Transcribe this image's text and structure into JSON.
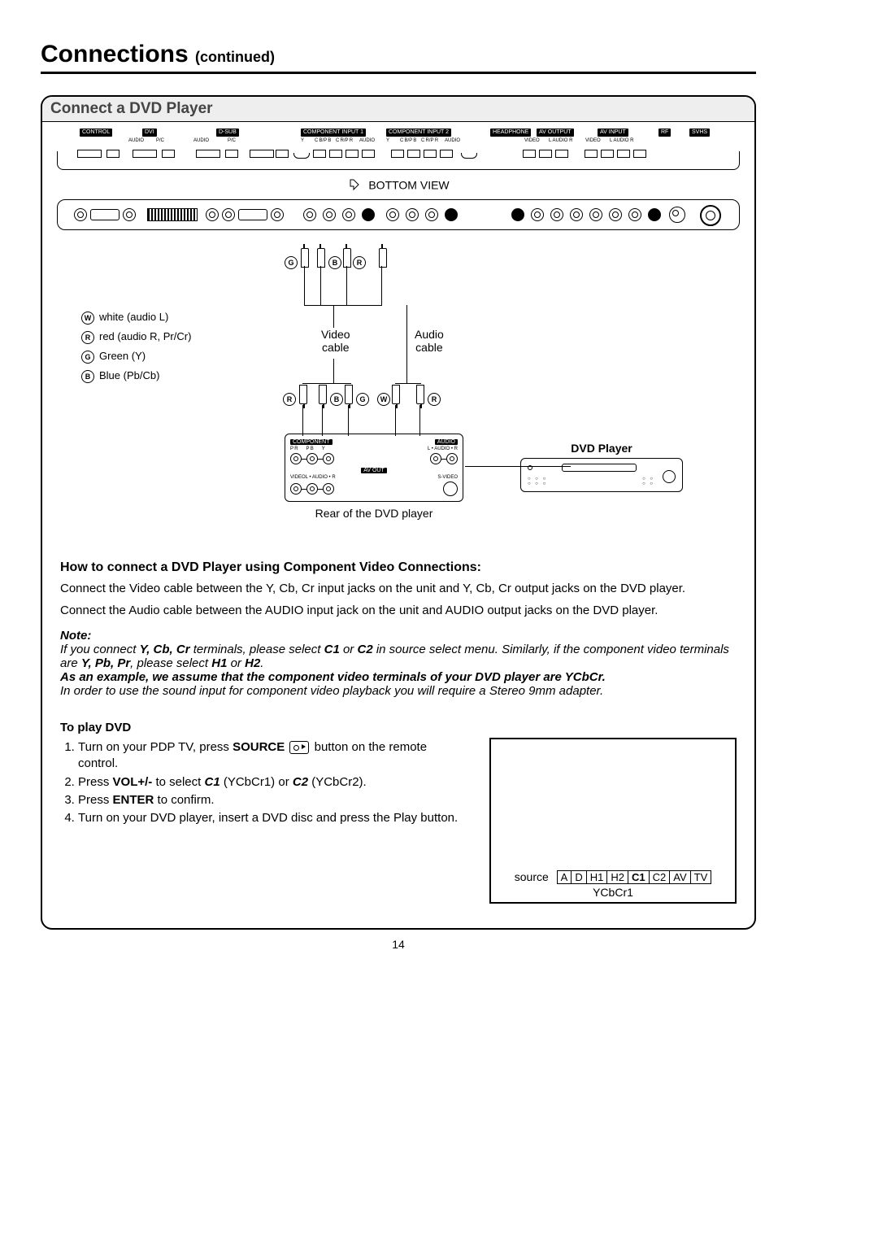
{
  "page_title": "Connections",
  "page_title_sub": "(continued)",
  "panel_title": "Connect a DVD Player",
  "top_labels": {
    "control": "CONTROL",
    "dvi": "DVI",
    "dsub": "D-SUB",
    "audio": "AUDIO",
    "pc": "P/C",
    "comp1": "COMPONENT INPUT 1",
    "comp2": "COMPONENT INPUT 2",
    "headphone": "HEADPHONE",
    "avout": "AV OUTPUT",
    "avin": "AV INPUT",
    "rf": "RF",
    "svhs": "SVHS",
    "y": "Y",
    "cbpb": "C B/P B",
    "crpr": "C R/P R",
    "video": "VIDEO",
    "laudior": "L  AUDIO  R"
  },
  "bottom_view": "BOTTOM VIEW",
  "legend": {
    "w": "white (audio L)",
    "r": "red (audio R, Pr/Cr)",
    "g": "Green (Y)",
    "b": "Blue (Pb/Cb)"
  },
  "cable_video": "Video\ncable",
  "cable_audio": "Audio\ncable",
  "dvd_label": "DVD Player",
  "rear": {
    "component": "COMPONENT",
    "audio": "AUDIO",
    "laudior": "L • AUDIO • R",
    "avout": "AV OUT",
    "video": "VIDEO",
    "svideo": "S-VIDEO",
    "y": "Y",
    "pb": "P B",
    "pr": "P R",
    "caption": "Rear of the DVD player"
  },
  "howto_head": "How to connect a DVD Player using Component Video Connections:",
  "howto_p1": "Connect the Video cable between the Y, Cb, Cr input jacks on the unit and Y, Cb, Cr output jacks on the DVD player.",
  "howto_p2": "Connect the Audio cable between the AUDIO input jack on the unit and AUDIO output jacks on the DVD player.",
  "note_head": "Note:",
  "note_line1a": "If you connect ",
  "note_line1b": "Y, Cb, Cr",
  "note_line1c": " terminals, please select ",
  "note_line1d": "C1",
  "note_line1e": " or ",
  "note_line1f": "C2",
  "note_line1g": " in source select menu. Similarly, if the component video terminals are ",
  "note_line1h": "Y, Pb, Pr",
  "note_line1i": ", please select ",
  "note_line1j": "H1",
  "note_line1k": " or ",
  "note_line1l": "H2",
  "note_line1m": ".",
  "note_line2": "As an example, we assume that the component video terminals of your DVD player are YCbCr.",
  "note_line3": "In order to use the sound input for component video playback you will require a Stereo 9mm adapter.",
  "play_head": "To play DVD",
  "play_steps": {
    "s1a": "Turn on your PDP TV, press ",
    "s1b": "SOURCE",
    "s1c": " button on the remote control.",
    "s2a": "Press ",
    "s2b": "VOL+/-",
    "s2c": " to select ",
    "s2d": "C1",
    "s2e": " (YCbCr1) or ",
    "s2f": "C2",
    "s2g": " (YCbCr2).",
    "s3a": "Press ",
    "s3b": "ENTER",
    "s3c": " to confirm.",
    "s4": "Turn on your DVD player, insert a DVD disc and press the Play button."
  },
  "osd": {
    "source": "source",
    "cells": [
      "A",
      "D",
      "H1",
      "H2",
      "C1",
      "C2",
      "AV",
      "TV"
    ],
    "selected": "C1",
    "sub": "YCbCr1"
  },
  "page_number": "14"
}
